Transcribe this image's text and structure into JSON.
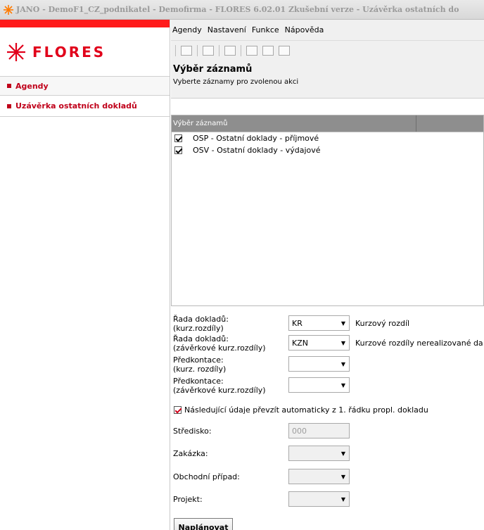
{
  "window": {
    "title": "JANO - DemoF1_CZ_podnikatel - Demofirma - FLORES 6.02.01 Zkušební verze - Uzávěrka ostatních do"
  },
  "sidebar": {
    "logo_text": "FLORES",
    "items": [
      {
        "label": "Agendy"
      },
      {
        "label": "Uzávěrka ostatních dokladů"
      }
    ]
  },
  "menu": {
    "items": [
      "Agendy",
      "Nastavení",
      "Funkce",
      "Nápověda"
    ]
  },
  "header": {
    "title": "Výběr záznamů",
    "subtitle": "Vyberte záznamy pro zvolenou akci"
  },
  "list": {
    "column_header": "Výběr záznamů",
    "rows": [
      {
        "label": "OSP - Ostatní doklady - příjmové",
        "checked": true
      },
      {
        "label": "OSV - Ostatní doklady - výdajové",
        "checked": true
      }
    ]
  },
  "form": {
    "rada_kurz": {
      "label_1": "Řada dokladů:",
      "label_2": "(kurz.rozdíly)",
      "value": "KR",
      "desc": "Kurzový rozdíl"
    },
    "rada_zav": {
      "label_1": "Řada dokladů:",
      "label_2": "(závěrkové kurz.rozdíly)",
      "value": "KZN",
      "desc": "Kurzové rozdíly nerealizované da"
    },
    "predk_kurz": {
      "label_1": "Předkontace:",
      "label_2": "(kurz. rozdíly)",
      "value": ""
    },
    "predk_zav": {
      "label_1": "Předkontace:",
      "label_2": "(závěrkové kurz.rozdíly)",
      "value": ""
    },
    "auto": {
      "label": "Následující údaje převzít automaticky z 1. řádku propl. dokladu",
      "checked": true
    },
    "stredisko": {
      "label": "Středisko:",
      "value": "000"
    },
    "zakazka": {
      "label": "Zakázka:",
      "value": ""
    },
    "obchodni": {
      "label": "Obchodní případ:",
      "value": ""
    },
    "projekt": {
      "label": "Projekt:",
      "value": ""
    }
  },
  "buttons": {
    "plan": "Naplánovat"
  },
  "colors": {
    "brand_red": "#e1001a",
    "sidebar_accent": "#ff1a1a"
  }
}
